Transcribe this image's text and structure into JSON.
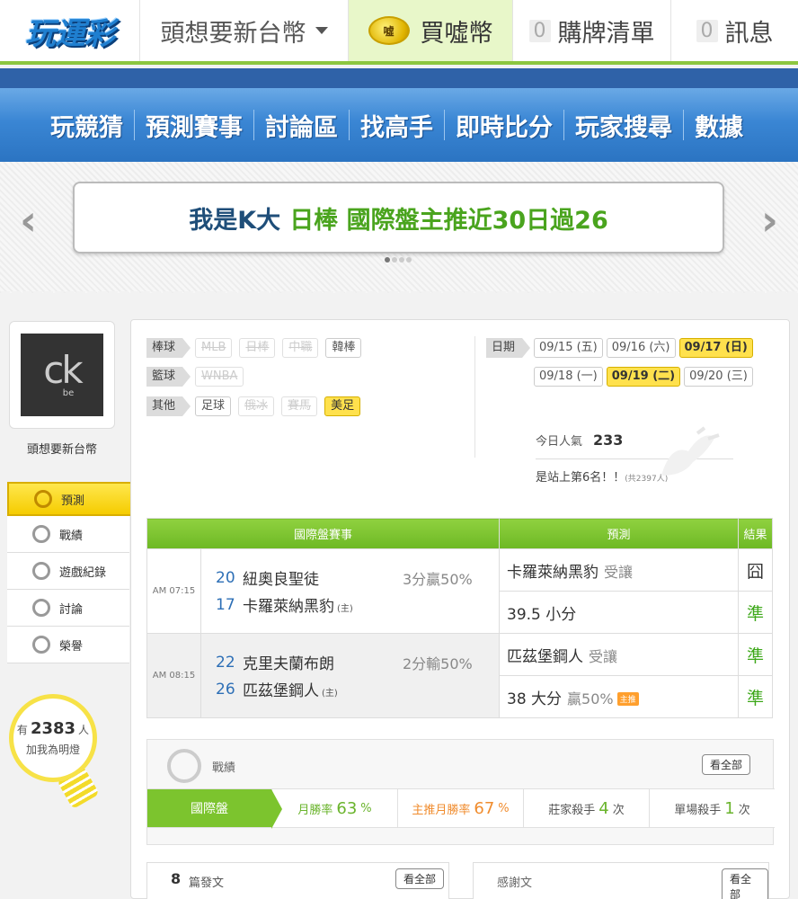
{
  "header": {
    "logo": "玩運彩",
    "user_name": "頭想要新台幣",
    "buy_coins": "買噓幣",
    "coin_icon_text": "噓",
    "cart": {
      "count": "0",
      "label": "購牌清單"
    },
    "messages": {
      "count": "0",
      "label": "訊息"
    }
  },
  "nav": [
    "玩競猜",
    "預測賽事",
    "討論區",
    "找高手",
    "即時比分",
    "玩家搜尋",
    "數據"
  ],
  "banner": {
    "part1": "我是K大",
    "part2": "日棒 國際盤主推近30日過26",
    "arrow_left": "‹",
    "arrow_right": "›"
  },
  "profile": {
    "avatar_text": "ck",
    "avatar_sub": "be",
    "name": "頭想要新台幣",
    "menu": [
      "預測",
      "戰績",
      "遊戲紀錄",
      "討論",
      "榮譽"
    ],
    "fans_prefix": "有",
    "fans_count": "2383",
    "fans_unit": "人",
    "fans_cta": "加我為明燈"
  },
  "filters": {
    "baseball": {
      "label": "棒球",
      "tags": [
        "MLB",
        "日棒",
        "中職",
        "韓棒"
      ]
    },
    "basketball": {
      "label": "籃球",
      "tags": [
        "WNBA"
      ]
    },
    "other": {
      "label": "其他",
      "tags": [
        "足球",
        "俄冰",
        "賽馬",
        "美足"
      ]
    }
  },
  "dates": {
    "label": "日期",
    "items": [
      "09/15 (五)",
      "09/16 (六)",
      "09/17 (日)",
      "09/18 (一)",
      "09/19 (二)",
      "09/20 (三)"
    ]
  },
  "popularity": {
    "label": "今日人氣",
    "value": "233",
    "rank": "是站上第6名！！",
    "rank_total": "(共2397人)"
  },
  "table": {
    "headers": [
      "國際盤賽事",
      "預測",
      "結果"
    ],
    "games": [
      {
        "time": "AM 07:15",
        "away_score": "20",
        "away": "紐奧良聖徒",
        "home_score": "17",
        "home": "卡羅萊納黑豹",
        "home_tag": "(主)",
        "spread": "3分贏50%",
        "pick1": "卡羅萊納黑豹",
        "pick1_sub": "受讓",
        "res1": "囧",
        "pick2": "39.5 小分",
        "res2": "準"
      },
      {
        "time": "AM 08:15",
        "away_score": "22",
        "away": "克里夫蘭布朗",
        "home_score": "26",
        "home": "匹茲堡鋼人",
        "home_tag": "(主)",
        "spread": "2分輸50%",
        "pick1": "匹茲堡鋼人",
        "pick1_sub": "受讓",
        "res1": "準",
        "pick2": "38 大分",
        "pick2_sub": "贏50%",
        "pick2_badge": "主推",
        "res2": "準"
      }
    ]
  },
  "record": {
    "title": "戰績",
    "view_all": "看全部",
    "lead": "國際盤",
    "month_win": {
      "label": "月勝率",
      "value": "63",
      "unit": "%"
    },
    "main_win": {
      "label": "主推月勝率",
      "value": "67",
      "unit": "%"
    },
    "banker_kill": {
      "label": "莊家殺手",
      "value": "4",
      "unit": "次"
    },
    "single_kill": {
      "label": "單場殺手",
      "value": "1",
      "unit": "次"
    }
  },
  "posts": {
    "count": "8",
    "label": "篇發文",
    "view_all": "看全部"
  },
  "thanks": {
    "label": "感謝文",
    "view_all": "看全部"
  }
}
